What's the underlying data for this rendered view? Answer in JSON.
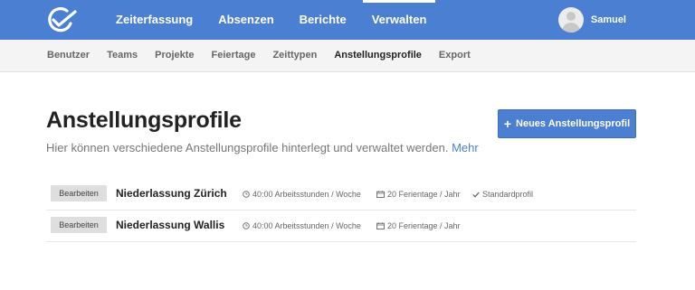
{
  "header": {
    "nav": [
      {
        "label": "Zeiterfassung"
      },
      {
        "label": "Absenzen"
      },
      {
        "label": "Berichte"
      },
      {
        "label": "Verwalten",
        "active": true
      }
    ],
    "user_name": "Samuel",
    "accent_color": "#4a7fd2",
    "logo_icon": "clock-check-icon"
  },
  "subnav": [
    {
      "label": "Benutzer"
    },
    {
      "label": "Teams"
    },
    {
      "label": "Projekte"
    },
    {
      "label": "Feiertage"
    },
    {
      "label": "Zeittypen"
    },
    {
      "label": "Anstellungsprofile",
      "active": true
    },
    {
      "label": "Export"
    }
  ],
  "page": {
    "title": "Anstellungsprofile",
    "description": "Hier können verschiedene Anstellungsprofile hinterlegt und verwaltet werden.",
    "more_link": "Mehr",
    "new_button": "Neues Anstellungsprofil"
  },
  "profiles": [
    {
      "edit_label": "Bearbeiten",
      "name": "Niederlassung Zürich",
      "hours": "40:00 Arbeitsstunden / Woche",
      "vacation": "20 Ferientage / Jahr",
      "standard": "Standardprofil"
    },
    {
      "edit_label": "Bearbeiten",
      "name": "Niederlassung Wallis",
      "hours": "40:00 Arbeitsstunden / Woche",
      "vacation": "20 Ferientage / Jahr"
    }
  ]
}
